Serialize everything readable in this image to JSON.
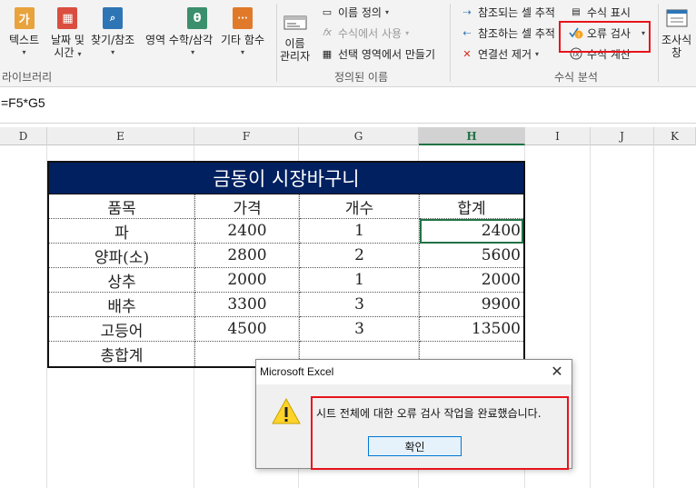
{
  "ribbon": {
    "function_library": {
      "buttons": [
        {
          "label": "텍스트",
          "arrow": "▾",
          "icon": "가",
          "color": "#e8a33d"
        },
        {
          "label": "날짜 및",
          "label2": "시간",
          "arrow": "▾",
          "icon": "▦",
          "color": "#d94e3f"
        },
        {
          "label": "찾기/참조",
          "arrow": "▾",
          "icon": "🔍",
          "color": "#2e75b6"
        },
        {
          "label": "수학/삼각",
          "label_prefix": "영역",
          "arrow": "▾",
          "icon": "θ",
          "color": "#3c8f6d"
        },
        {
          "label": "기타",
          "label_suffix": "함수",
          "arrow": "▾",
          "icon": "···",
          "color": "#e07a2a"
        }
      ],
      "group_label": "라이브러리"
    },
    "defined_names": {
      "name_manager_label": "이름",
      "name_manager_label2": "관리자",
      "define_name": "이름 정의",
      "use_in_formula": "수식에서 사용",
      "create_from_selection": "선택 영역에서 만들기",
      "group_label": "정의된 이름"
    },
    "formula_auditing": {
      "trace_precedents": "참조되는 셀 추적",
      "trace_dependents": "참조하는 셀 추적",
      "remove_arrows": "연결선 제거",
      "show_formulas": "수식 표시",
      "error_checking": "오류 검사",
      "evaluate_formula": "수식 계산",
      "group_label": "수식 분석"
    },
    "watch_window": {
      "label": "조사식",
      "label2": "창"
    }
  },
  "formula_bar": {
    "text": "=F5*G5"
  },
  "columns": [
    {
      "label": "D"
    },
    {
      "label": "E"
    },
    {
      "label": "F"
    },
    {
      "label": "G"
    },
    {
      "label": "H",
      "active": true
    },
    {
      "label": "I"
    },
    {
      "label": "J"
    },
    {
      "label": "K"
    }
  ],
  "table": {
    "title": "금동이 시장바구니",
    "headers": [
      "품목",
      "가격",
      "개수",
      "합계"
    ],
    "rows": [
      {
        "item": "파",
        "price": "2400",
        "qty": "1",
        "total": "2400"
      },
      {
        "item": "양파(소)",
        "price": "2800",
        "qty": "2",
        "total": "5600"
      },
      {
        "item": "상추",
        "price": "2000",
        "qty": "1",
        "total": "2000"
      },
      {
        "item": "배추",
        "price": "3300",
        "qty": "3",
        "total": "9900"
      },
      {
        "item": "고등어",
        "price": "4500",
        "qty": "3",
        "total": "13500"
      },
      {
        "item": "총합계",
        "price": "",
        "qty": "",
        "total": ""
      }
    ],
    "title_bg": "#002060"
  },
  "dialog": {
    "title": "Microsoft Excel",
    "message": "시트 전체에 대한 오류 검사 작업을 완료했습니다.",
    "ok_label": "확인",
    "close_glyph": "✕"
  },
  "highlight_color": "#e8131b"
}
